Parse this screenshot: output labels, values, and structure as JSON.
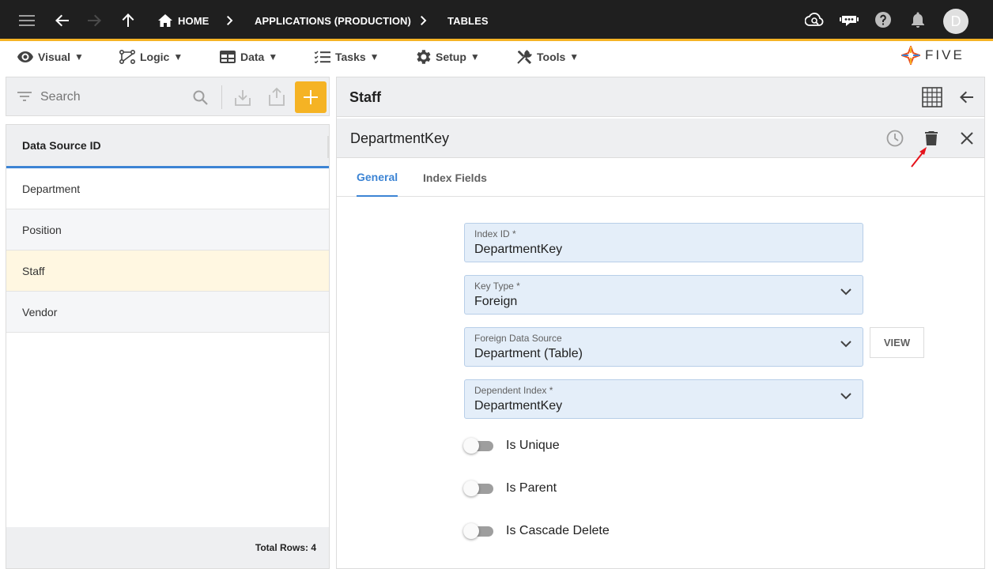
{
  "topbar": {
    "breadcrumbs": [
      {
        "label": "HOME"
      },
      {
        "label": "APPLICATIONS (PRODUCTION)"
      },
      {
        "label": "TABLES"
      }
    ],
    "avatar_letter": "D"
  },
  "menu": {
    "items": [
      {
        "label": "Visual",
        "icon": "eye-icon"
      },
      {
        "label": "Logic",
        "icon": "logic-icon"
      },
      {
        "label": "Data",
        "icon": "table-icon"
      },
      {
        "label": "Tasks",
        "icon": "tasks-icon"
      },
      {
        "label": "Setup",
        "icon": "gear-icon"
      },
      {
        "label": "Tools",
        "icon": "tools-icon"
      }
    ],
    "caret": "▼",
    "logo_text": "FIVE"
  },
  "left": {
    "search_placeholder": "Search",
    "column_header": "Data Source ID",
    "rows": [
      {
        "label": "Department"
      },
      {
        "label": "Position"
      },
      {
        "label": "Staff"
      },
      {
        "label": "Vendor"
      }
    ],
    "selected_index": 2,
    "footer": "Total Rows: 4"
  },
  "right": {
    "title": "Staff",
    "record_title": "DepartmentKey",
    "tabs": [
      {
        "label": "General"
      },
      {
        "label": "Index Fields"
      }
    ],
    "active_tab": 0,
    "fields": [
      {
        "label": "Index ID *",
        "value": "DepartmentKey",
        "dropdown": false
      },
      {
        "label": "Key Type *",
        "value": "Foreign",
        "dropdown": true
      },
      {
        "label": "Foreign Data Source",
        "value": "Department (Table)",
        "dropdown": true
      },
      {
        "label": "Dependent Index *",
        "value": "DepartmentKey",
        "dropdown": true
      }
    ],
    "view_button": "VIEW",
    "toggles": [
      {
        "label": "Is Unique",
        "on": false
      },
      {
        "label": "Is Parent",
        "on": false
      },
      {
        "label": "Is Cascade Delete",
        "on": false
      }
    ]
  },
  "colors": {
    "accent": "#f5b324",
    "primary": "#3c84d4",
    "topbar": "#1f1f1f",
    "field_bg": "#e4eef9",
    "selected_row": "#fff7e1",
    "annotation_arrow": "#e5131b"
  }
}
